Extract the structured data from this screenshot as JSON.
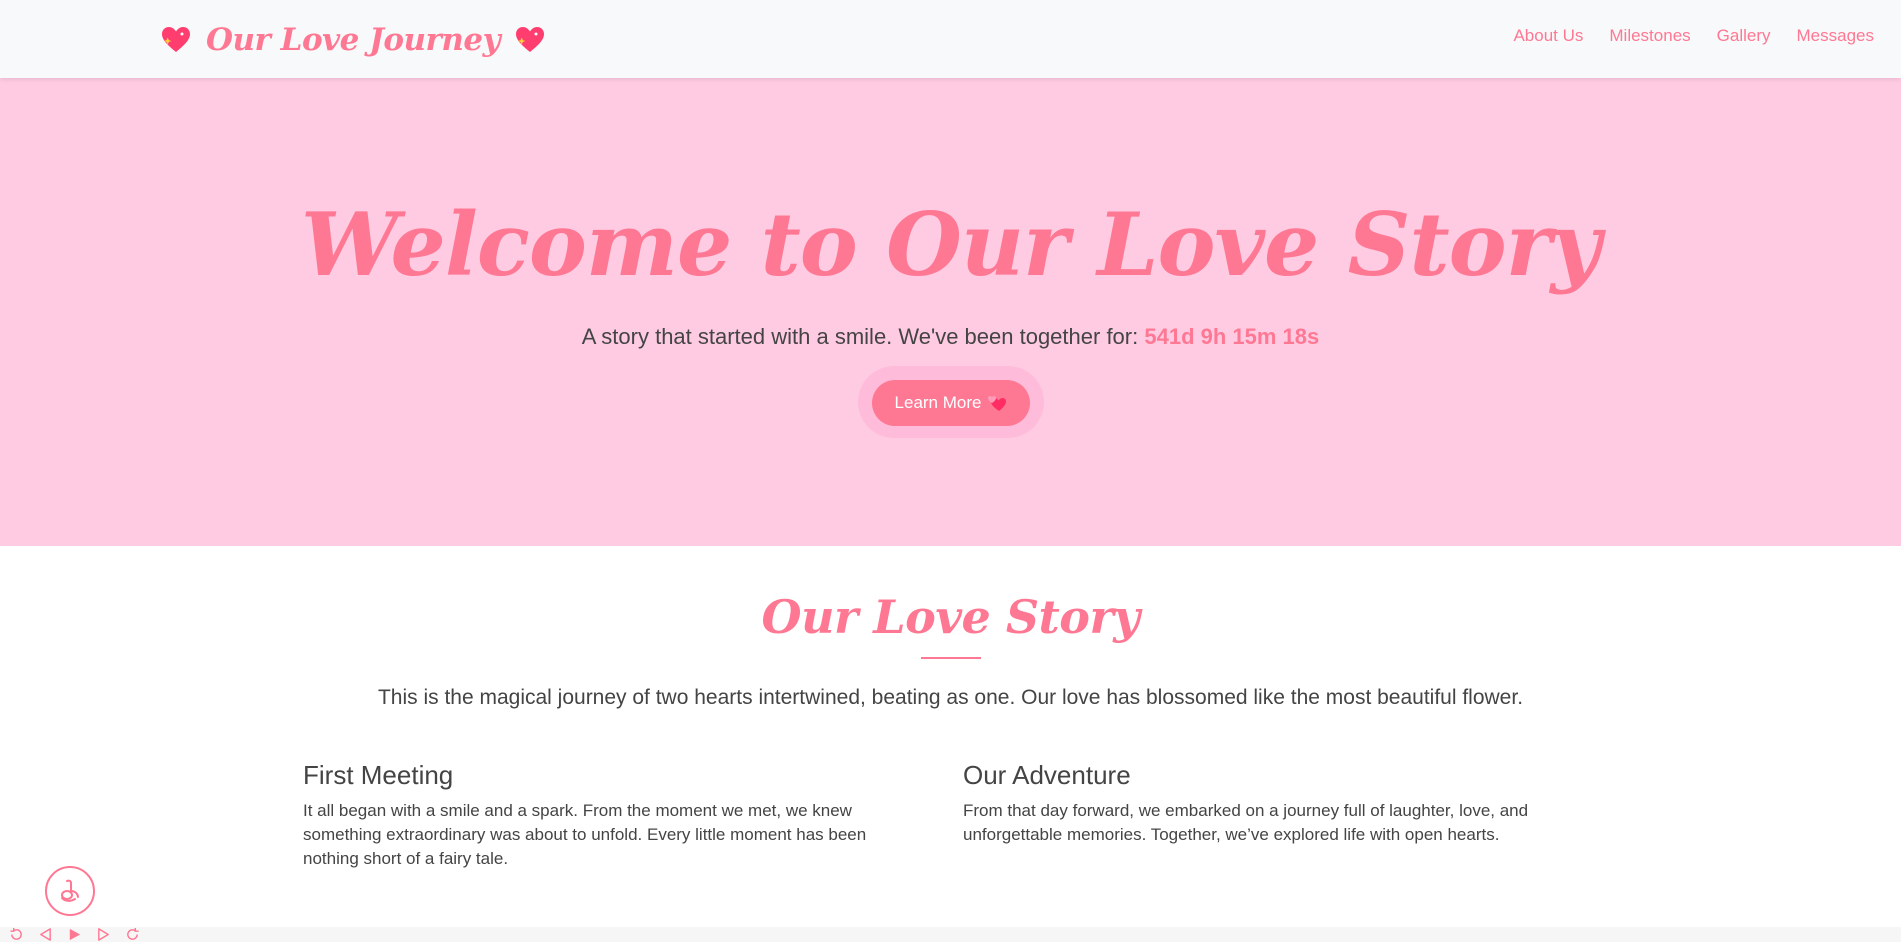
{
  "navbar": {
    "brand": "Our Love Journey",
    "links": [
      {
        "label": "About Us"
      },
      {
        "label": "Milestones"
      },
      {
        "label": "Gallery"
      },
      {
        "label": "Messages"
      }
    ]
  },
  "hero": {
    "title": "Welcome to Our Love Story",
    "subtitle": "A story that started with a smile. We've been together for:",
    "counter": "541d 9h 15m 18s",
    "button_label": "Learn More"
  },
  "story": {
    "title": "Our Love Story",
    "lead": "This is the magical journey of two hearts intertwined, beating as one. Our love has blossomed like the most beautiful flower.",
    "columns": [
      {
        "heading": "First Meeting",
        "text": "It all began with a smile and a spark. From the moment we met, we knew something extraordinary was about to unfold. Every little moment has been nothing short of a fairy tale."
      },
      {
        "heading": "Our Adventure",
        "text": "From that day forward, we embarked on a journey full of laughter, love, and unforgettable memories. Together, we’ve explored life with open hearts."
      }
    ]
  },
  "icons": {
    "brand_left": "sparkling-heart-icon",
    "brand_right": "sparkling-heart-icon",
    "button": "two-hearts-icon",
    "music": "music-note-icon",
    "controls": [
      "replay-icon",
      "prev-icon",
      "play-icon",
      "next-icon",
      "repeat-icon"
    ]
  },
  "colors": {
    "accent": "#ff7893",
    "hero_bg": "#ffcbe3",
    "navbar_bg": "#f8f9fa",
    "text": "#444444"
  }
}
